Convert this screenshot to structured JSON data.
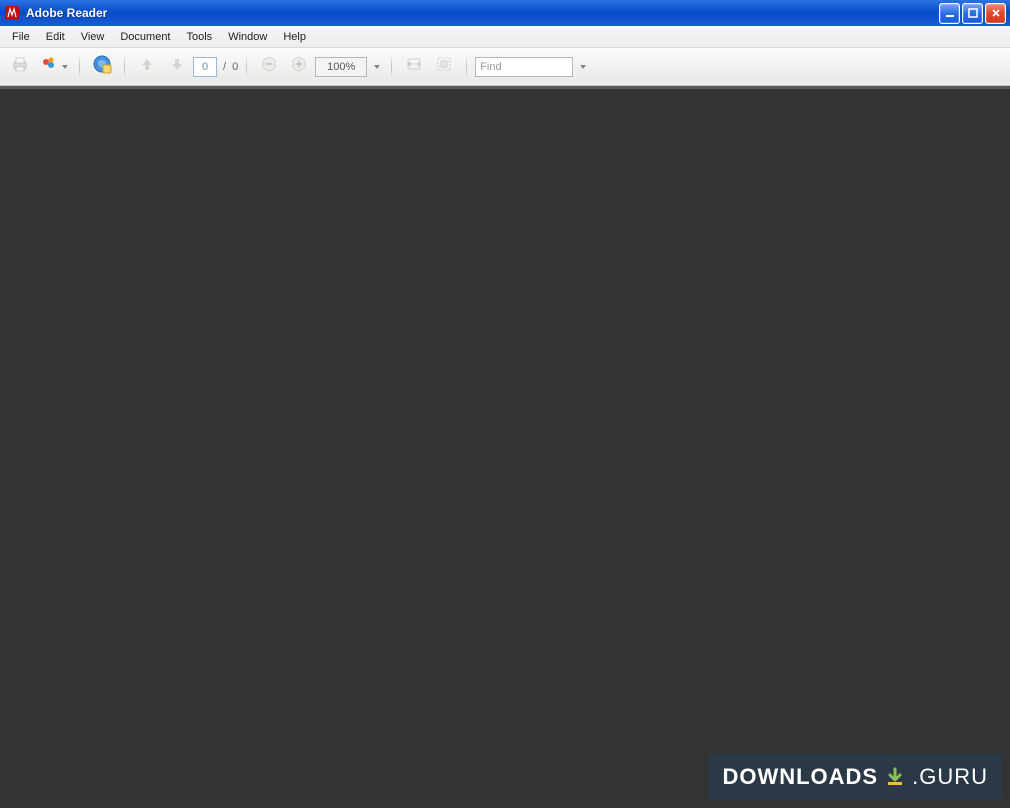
{
  "titlebar": {
    "title": "Adobe Reader"
  },
  "menubar": {
    "items": [
      "File",
      "Edit",
      "View",
      "Document",
      "Tools",
      "Window",
      "Help"
    ]
  },
  "toolbar": {
    "page_current": "0",
    "page_total": "0",
    "page_separator": "/",
    "zoom_value": "100%",
    "find_placeholder": "Find"
  },
  "watermark": {
    "text_left": "DOWNLOADS",
    "text_right": ".GURU"
  }
}
